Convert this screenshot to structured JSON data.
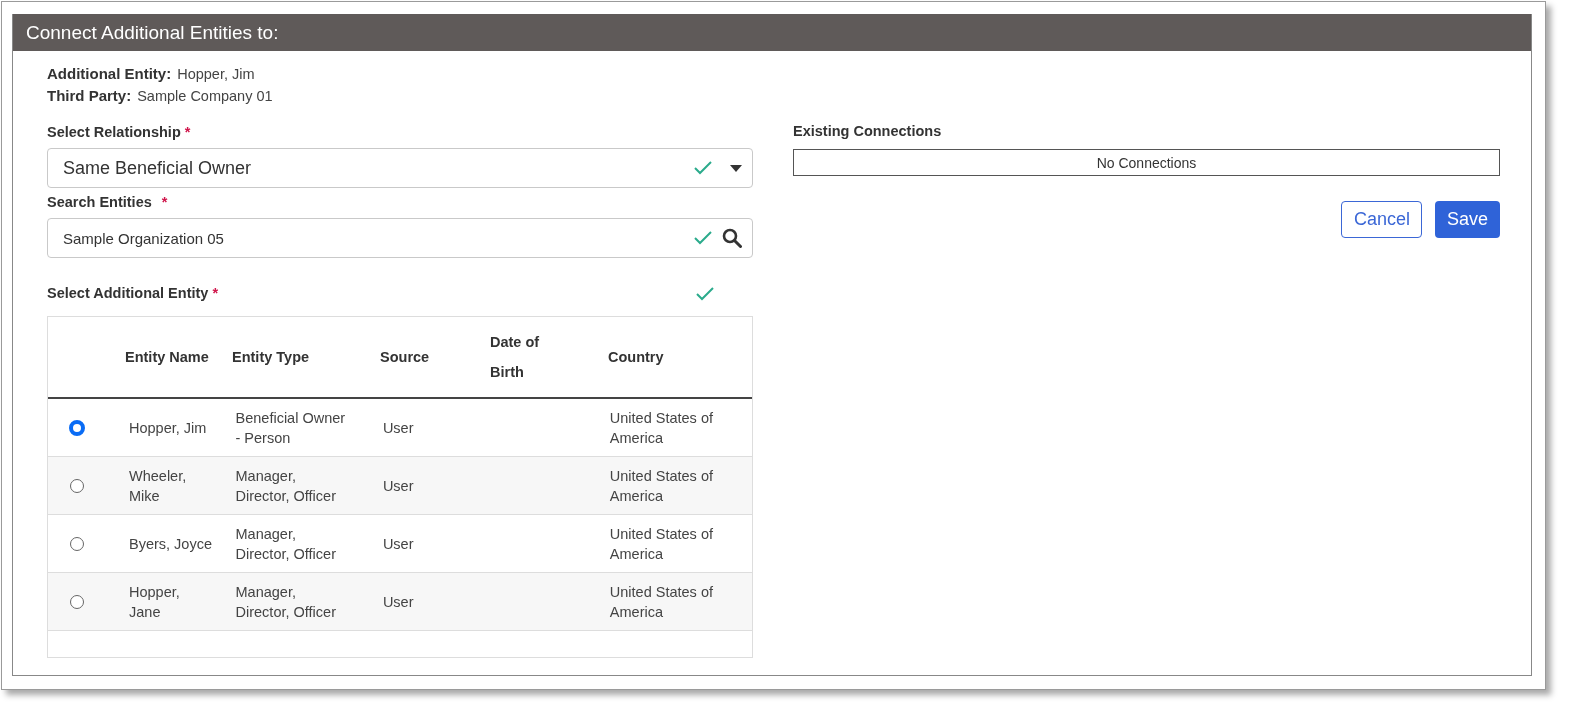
{
  "panel": {
    "title": "Connect Additional Entities to:"
  },
  "summary": [
    {
      "label": "Additional Entity:",
      "value": "Hopper, Jim"
    },
    {
      "label": "Third Party:",
      "value": "Sample Company 01"
    }
  ],
  "relationship": {
    "label": "Select Relationship",
    "required_mark": "*",
    "value": "Same Beneficial Owner",
    "valid": true
  },
  "search": {
    "label": "Search Entities",
    "required_mark": "*",
    "value": "Sample Organization 05",
    "valid": true
  },
  "entity_select": {
    "label": "Select Additional Entity",
    "required_mark": "*",
    "valid": true
  },
  "table": {
    "columns": [
      "Entity Name",
      "Entity Type",
      "Source",
      "Date of Birth",
      "Country"
    ],
    "rows": [
      {
        "selected": true,
        "cells": [
          "Hopper, Jim",
          "Beneficial Owner - Person",
          "User",
          "",
          "United States of America"
        ]
      },
      {
        "selected": false,
        "cells": [
          "Wheeler, Mike",
          "Manager, Director, Officer",
          "User",
          "",
          "United States of America"
        ]
      },
      {
        "selected": false,
        "cells": [
          "Byers, Joyce",
          "Manager, Director, Officer",
          "User",
          "",
          "United States of America"
        ]
      },
      {
        "selected": false,
        "cells": [
          "Hopper, Jane",
          "Manager, Director, Officer",
          "User",
          "",
          "United States of America"
        ]
      }
    ]
  },
  "existing_connections": {
    "label": "Existing Connections",
    "empty_text": "No Connections"
  },
  "buttons": {
    "cancel": "Cancel",
    "save": "Save"
  }
}
